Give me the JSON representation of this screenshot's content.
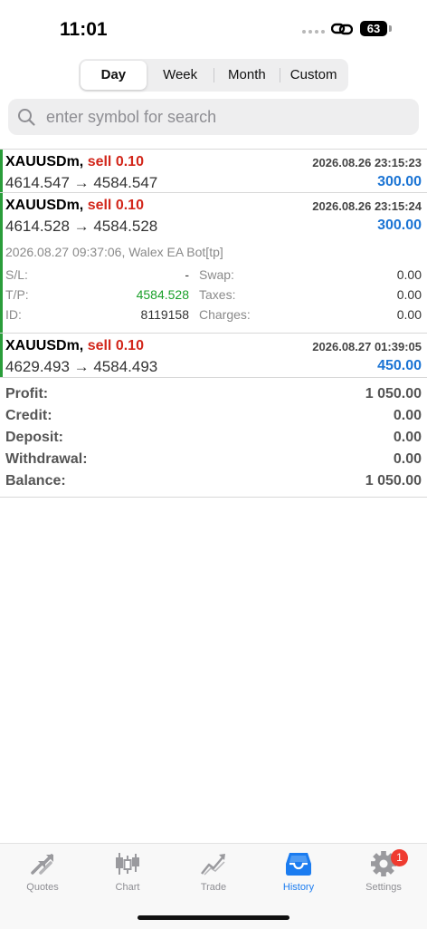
{
  "status_bar": {
    "time": "11:01",
    "battery": "63"
  },
  "period_tabs": [
    {
      "label": "Day",
      "active": true
    },
    {
      "label": "Week",
      "active": false
    },
    {
      "label": "Month",
      "active": false
    },
    {
      "label": "Custom",
      "active": false
    }
  ],
  "search": {
    "placeholder": "enter symbol for search",
    "value": ""
  },
  "deals": [
    {
      "symbol": "XAUUSDm,",
      "type": "sell 0.10",
      "datetime": "2026.08.26 23:15:23",
      "prices": "4614.547 → 4584.547",
      "profit": "300.00"
    },
    {
      "symbol": "XAUUSDm,",
      "type": "sell 0.10",
      "datetime": "2026.08.26 23:15:24",
      "prices": "4614.528 → 4584.528",
      "profit": "300.00",
      "comment": "2026.08.27 09:37:06, Walex EA Bot[tp]",
      "details": {
        "sl_label": "S/L:",
        "sl_value": "-",
        "tp_label": "T/P:",
        "tp_value": "4584.528",
        "id_label": "ID:",
        "id_value": "8119158",
        "swap_label": "Swap:",
        "swap_value": "0.00",
        "taxes_label": "Taxes:",
        "taxes_value": "0.00",
        "charges_label": "Charges:",
        "charges_value": "0.00"
      }
    },
    {
      "symbol": "XAUUSDm,",
      "type": "sell 0.10",
      "datetime": "2026.08.27 01:39:05",
      "prices": "4629.493 → 4584.493",
      "profit": "450.00"
    }
  ],
  "summary": [
    {
      "label": "Profit:",
      "value": "1 050.00"
    },
    {
      "label": "Credit:",
      "value": "0.00"
    },
    {
      "label": "Deposit:",
      "value": "0.00"
    },
    {
      "label": "Withdrawal:",
      "value": "0.00"
    },
    {
      "label": "Balance:",
      "value": "1 050.00"
    }
  ],
  "tabbar": {
    "items": [
      {
        "label": "Quotes",
        "icon": "quotes-arrows-icon"
      },
      {
        "label": "Chart",
        "icon": "candlestick-chart-icon"
      },
      {
        "label": "Trade",
        "icon": "trend-line-icon"
      },
      {
        "label": "History",
        "icon": "inbox-tray-icon",
        "active": true
      },
      {
        "label": "Settings",
        "icon": "gear-icon",
        "badge": "1"
      }
    ]
  },
  "colors": {
    "sell": "#d2261a",
    "profit": "#1b74d4",
    "buy_bar": "#2a9d3a",
    "active_tab": "#1b7cf0",
    "badge": "#ef3b30"
  }
}
